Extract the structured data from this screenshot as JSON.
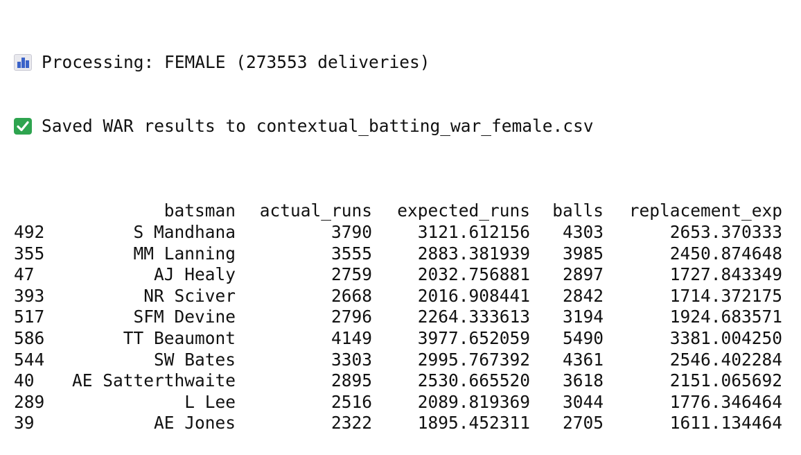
{
  "messages": [
    {
      "icon": "bar-chart-icon",
      "text": "Processing: FEMALE (273553 deliveries)"
    },
    {
      "icon": "check-mark-icon",
      "text": "Saved WAR results to contextual_batting_war_female.csv"
    }
  ],
  "table": {
    "columns": [
      "batsman",
      "actual_runs",
      "expected_runs",
      "balls",
      "replacement_exp"
    ],
    "rows": [
      {
        "index": "492",
        "batsman": "S Mandhana",
        "actual_runs": "3790",
        "expected_runs": "3121.612156",
        "balls": "4303",
        "replacement_exp": "2653.370333"
      },
      {
        "index": "355",
        "batsman": "MM Lanning",
        "actual_runs": "3555",
        "expected_runs": "2883.381939",
        "balls": "3985",
        "replacement_exp": "2450.874648"
      },
      {
        "index": "47",
        "batsman": "AJ Healy",
        "actual_runs": "2759",
        "expected_runs": "2032.756881",
        "balls": "2897",
        "replacement_exp": "1727.843349"
      },
      {
        "index": "393",
        "batsman": "NR Sciver",
        "actual_runs": "2668",
        "expected_runs": "2016.908441",
        "balls": "2842",
        "replacement_exp": "1714.372175"
      },
      {
        "index": "517",
        "batsman": "SFM Devine",
        "actual_runs": "2796",
        "expected_runs": "2264.333613",
        "balls": "3194",
        "replacement_exp": "1924.683571"
      },
      {
        "index": "586",
        "batsman": "TT Beaumont",
        "actual_runs": "4149",
        "expected_runs": "3977.652059",
        "balls": "5490",
        "replacement_exp": "3381.004250"
      },
      {
        "index": "544",
        "batsman": "SW Bates",
        "actual_runs": "3303",
        "expected_runs": "2995.767392",
        "balls": "4361",
        "replacement_exp": "2546.402284"
      },
      {
        "index": "40",
        "batsman": "AE Satterthwaite",
        "actual_runs": "2895",
        "expected_runs": "2530.665520",
        "balls": "3618",
        "replacement_exp": "2151.065692"
      },
      {
        "index": "289",
        "batsman": "L Lee",
        "actual_runs": "2516",
        "expected_runs": "2089.819369",
        "balls": "3044",
        "replacement_exp": "1776.346464"
      },
      {
        "index": "39",
        "batsman": "AE Jones",
        "actual_runs": "2322",
        "expected_runs": "1895.452311",
        "balls": "2705",
        "replacement_exp": "1611.134464"
      }
    ]
  },
  "colors": {
    "text": "#111111",
    "background": "#ffffff",
    "check_green": "#2ea44f",
    "chart_blue": "#3a63c9"
  }
}
